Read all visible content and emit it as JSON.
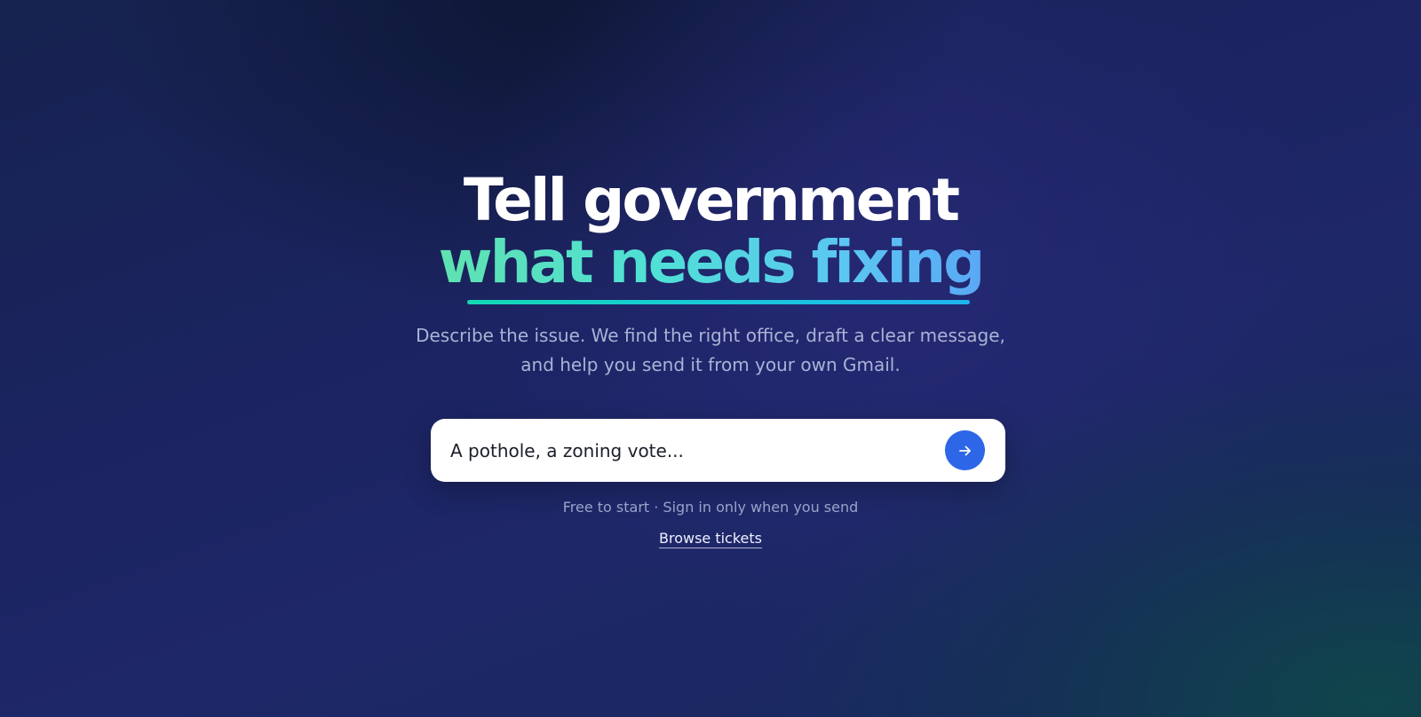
{
  "hero": {
    "headline_line1": "Tell government",
    "headline_line2": "what needs fixing",
    "subtitle_line1": "Describe the issue. We find the right office, draft a clear message,",
    "subtitle_line2": "and help you send it from your own Gmail."
  },
  "search": {
    "placeholder": "A pothole, a zoning vote...",
    "value": "",
    "submit_icon": "arrow-right-icon",
    "submit_color": "#2d67e8"
  },
  "note": "Free to start · Sign in only when you send",
  "browse_link": "Browse tickets",
  "colors": {
    "headline": "#ffffff",
    "accent_gradient_start": "#5fe2b0",
    "accent_gradient_end": "#5aa7f5",
    "subtitle": "#aab3d6",
    "background": "#1c2463"
  }
}
